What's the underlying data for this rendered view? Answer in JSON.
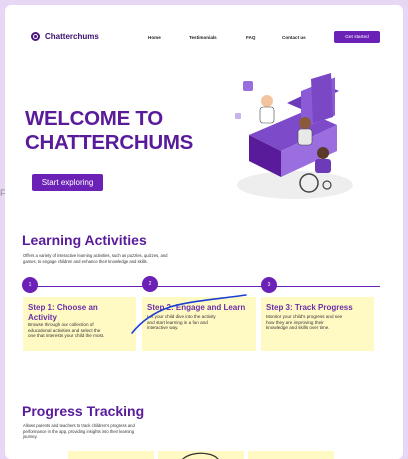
{
  "frame_label": "Frame",
  "nav": {
    "brand": "Chatterchums",
    "links": [
      "Home",
      "Testimonials",
      "FAQ",
      "Contact us"
    ],
    "cta": "Get started"
  },
  "hero": {
    "title_line1": "WELCOME TO",
    "title_line2": "CHATTERCHUMS",
    "button": "Start exploring"
  },
  "activities": {
    "title": "Learning Activities",
    "description_line1": "Offers a variety of interactive learning activities, such as puzzles, quizzes, and",
    "description_line2": "games, to engage children and enhance their knowledge and skills.",
    "steps": [
      {
        "number": "1",
        "title_line1": "Step 1: Choose an",
        "title_line2": "Activity",
        "desc": [
          "Browse through our collection of",
          "educational activities and select the",
          "one that interests your child the most."
        ]
      },
      {
        "number": "2",
        "title_line1": "Step 2: Engage and Learn",
        "title_line2": "",
        "desc": [
          "Let your child dive into the activity",
          "and start learning in a fun and",
          "interactive way."
        ]
      },
      {
        "number": "3",
        "title_line1": "Step 3: Track Progress",
        "title_line2": "",
        "desc": [
          "Monitor your child's progress and see",
          "how they are improving their",
          "knowledge and skills over time."
        ]
      }
    ]
  },
  "progress": {
    "title": "Progress Tracking",
    "description_line1": "Allows parents and teachers to track children's progress and",
    "description_line2": "performance in the app, providing insights into their learning",
    "description_line3": "journey."
  },
  "colors": {
    "brand_purple": "#5a1b9a",
    "button_purple": "#6b21b5",
    "card_yellow": "#fff9c4",
    "annotation_blue": "#1a3fd6"
  }
}
